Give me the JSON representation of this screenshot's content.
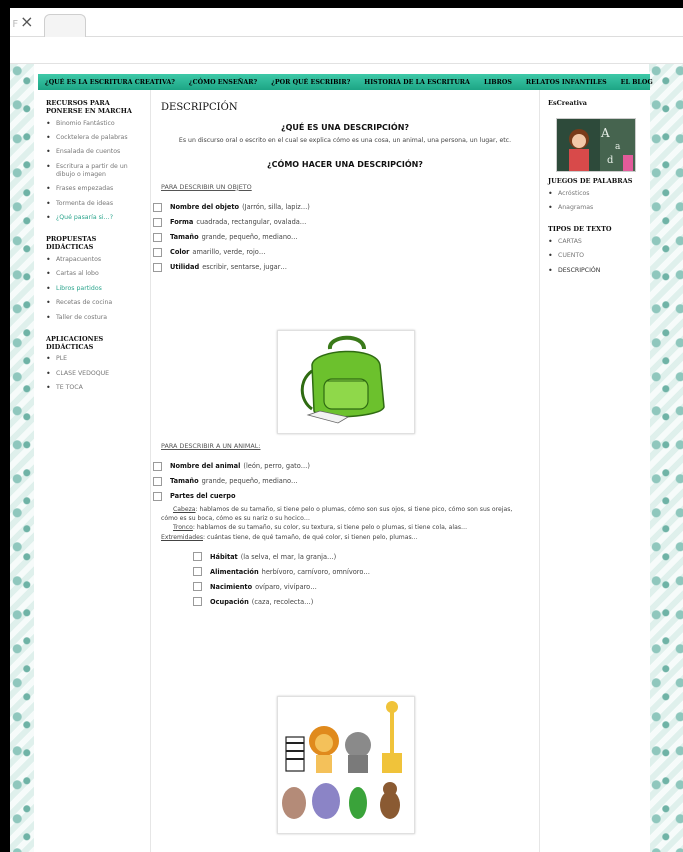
{
  "browser": {
    "close_glyph": "×",
    "partial_glyph": "F"
  },
  "nav": [
    "¿QUÉ ES LA ESCRITURA CREATIVA?",
    "¿CÓMO ENSEÑAR?",
    "¿POR QUÉ ESCRIBIR?",
    "HISTORIA DE LA ESCRITURA",
    "LIBROS",
    "RELATOS INFANTILES",
    "EL BLOG"
  ],
  "left_sidebar": {
    "recursos_title": "RECURSOS PARA PONERSE EN MARCHA",
    "recursos": [
      "Binomio Fantástico",
      "Cocktelera de palabras",
      "Ensalada de cuentos",
      "Escritura a partir de un dibujo o imagen",
      "Frases empezadas",
      "Tormenta de ideas",
      "¿Qué pasaría si…?"
    ],
    "propuestas_title": "PROPUESTAS DIDÁCTICAS",
    "propuestas": [
      "Atrapacuentos",
      "Cartas al lobo",
      "Libros partidos",
      "Recetas de cocina",
      "Taller de costura"
    ],
    "aplicaciones_title": "APLICACIONES DIDÁCTICAS",
    "aplicaciones": [
      "PLE",
      "CLASE VEDOQUE",
      "TE TOCA"
    ]
  },
  "right_sidebar": {
    "escreativa_title": "EsCreativa",
    "juegos_title": "JUEGOS DE PALABRAS",
    "juegos": [
      "Acrósticos",
      "Anagramas"
    ],
    "tipos_title": "TIPOS DE TEXTO",
    "tipos": [
      "CARTAS",
      "CUENTO",
      "DESCRIPCIÓN"
    ]
  },
  "main": {
    "title": "DESCRIPCIÓN",
    "q1": "¿QUÉ ES UNA DESCRIPCIÓN?",
    "q1_text": "Es un discurso oral o escrito en el cual se explica cómo es una cosa, un animal, una persona, un lugar, etc.",
    "q2": "¿CÓMO HACER UNA DESCRIPCIÓN?",
    "obj_heading": "PARA DESCRIBIR UN OBJETO",
    "obj_items": [
      {
        "label": "Nombre del objeto",
        "text": "(Jarrón, silla, lapiz…)"
      },
      {
        "label": "Forma",
        "text": "cuadrada, rectangular, ovalada…"
      },
      {
        "label": "Tamaño",
        "text": "grande, pequeño, mediano…"
      },
      {
        "label": "Color",
        "text": "amarillo, verde, rojo…"
      },
      {
        "label": "Utilidad",
        "text": "escribir, sentarse, jugar…"
      }
    ],
    "animal_heading": "PARA DESCRIBIR A UN ANIMAL:",
    "animal_items": [
      {
        "label": "Nombre del animal",
        "text": "(león, perro, gato…)"
      },
      {
        "label": "Tamaño",
        "text": "grande, pequeño, mediano…"
      },
      {
        "label": "Partes del cuerpo",
        "text": ""
      }
    ],
    "cabeza_label": "Cabeza",
    "cabeza_text": ": hablamos de su tamaño, si tiene pelo o plumas, cómo son sus ojos, si tiene pico, cómo son sus orejas, cómo es su boca, cómo es su nariz o su hocico…",
    "tronco_label": "Tronco",
    "tronco_text": ": hablamos de su tamaño, su color, su textura, si tiene pelo o plumas, si tiene cola, alas…",
    "extremidades_label": "Extremidades",
    "extremidades_text": ": cuántas tiene, de qué tamaño, de qué color, si tienen pelo, plumas…",
    "extra_items": [
      {
        "label": "Hábitat",
        "text": "(la selva, el mar, la granja…)"
      },
      {
        "label": "Alimentación",
        "text": "herbívoro, carnívoro, omnívoro…"
      },
      {
        "label": "Nacimiento",
        "text": "ovíparo, vivíparo…"
      },
      {
        "label": "Ocupación",
        "text": "(caza, recolecta…)"
      }
    ]
  },
  "colors": {
    "nav_top": "#3ec9a8",
    "nav_bottom": "#1da585",
    "link": "#2aa48c",
    "backpack": "#6cc12d"
  },
  "icons": [
    "backpack-illustration",
    "animals-illustration",
    "girl-chalkboard-photo"
  ]
}
